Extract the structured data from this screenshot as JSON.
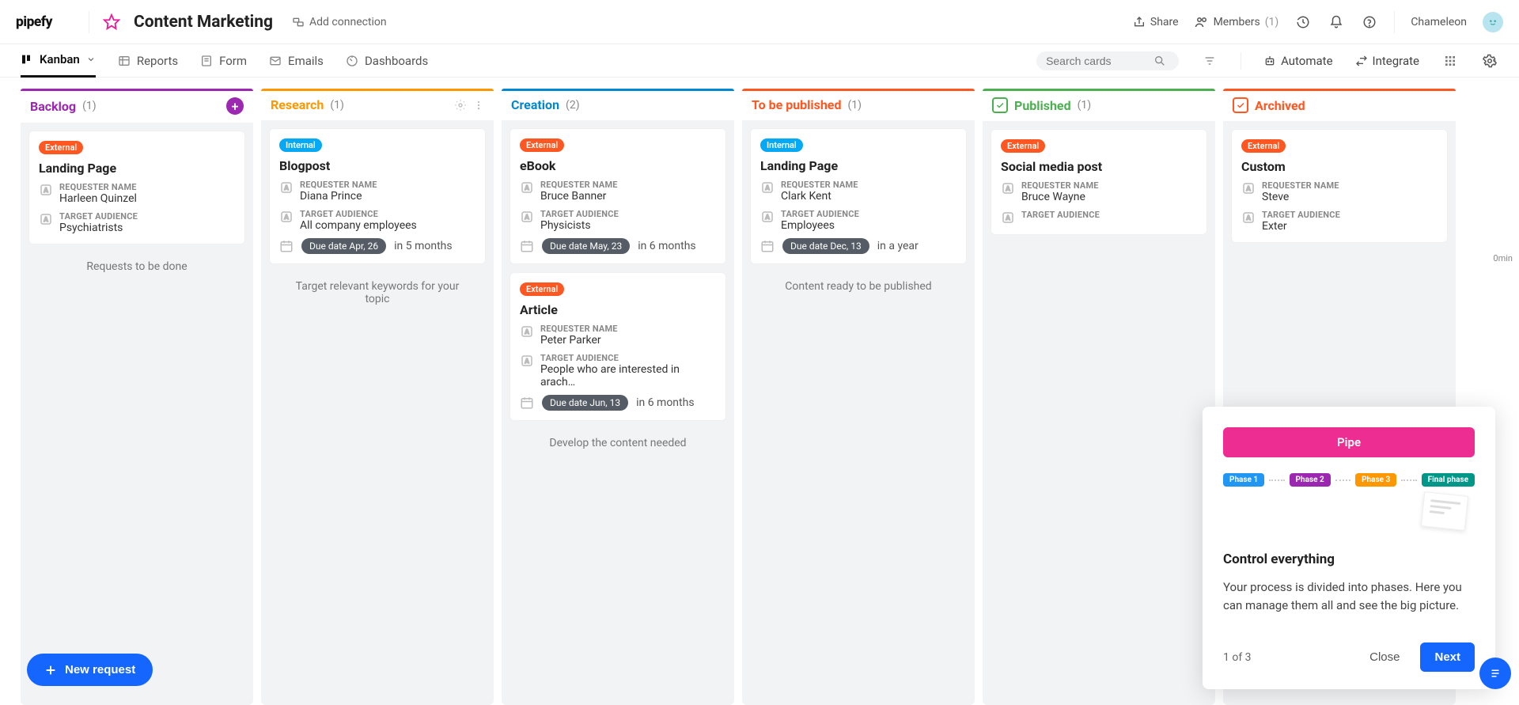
{
  "header": {
    "pipe_title": "Content Marketing",
    "add_connection": "Add connection",
    "share": "Share",
    "members": "Members",
    "members_count": "(1)",
    "user": "Chameleon"
  },
  "views": {
    "kanban": "Kanban",
    "reports": "Reports",
    "form": "Form",
    "emails": "Emails",
    "dashboards": "Dashboards",
    "search_ph": "Search cards",
    "automate": "Automate",
    "integrate": "Integrate"
  },
  "columns": [
    {
      "id": "backlog",
      "title": "Backlog",
      "count": "(1)",
      "color": "#9c27b0",
      "show_add": true,
      "desc": "Requests to be done",
      "cards": [
        {
          "label_type": "ext",
          "label": "External",
          "title": "Landing Page",
          "fields": [
            {
              "lbl": "REQUESTER NAME",
              "val": "Harleen Quinzel"
            },
            {
              "lbl": "TARGET AUDIENCE",
              "val": "Psychiatrists"
            }
          ]
        }
      ]
    },
    {
      "id": "research",
      "title": "Research",
      "count": "(1)",
      "color": "#ff9800",
      "show_gear": true,
      "desc": "Target relevant keywords for your topic",
      "cards": [
        {
          "label_type": "int",
          "label": "Internal",
          "title": "Blogpost",
          "fields": [
            {
              "lbl": "REQUESTER NAME",
              "val": "Diana Prince"
            },
            {
              "lbl": "TARGET AUDIENCE",
              "val": "All company employees"
            }
          ],
          "due": "Due date Apr, 26",
          "rel": "in 5 months"
        }
      ]
    },
    {
      "id": "creation",
      "title": "Creation",
      "count": "(2)",
      "color": "#0288d1",
      "desc": "Develop the content needed",
      "cards": [
        {
          "label_type": "ext",
          "label": "External",
          "title": "eBook",
          "fields": [
            {
              "lbl": "REQUESTER NAME",
              "val": "Bruce Banner"
            },
            {
              "lbl": "TARGET AUDIENCE",
              "val": "Physicists"
            }
          ],
          "due": "Due date May, 23",
          "rel": "in 6 months"
        },
        {
          "label_type": "ext",
          "label": "External",
          "title": "Article",
          "fields": [
            {
              "lbl": "REQUESTER NAME",
              "val": "Peter Parker"
            },
            {
              "lbl": "TARGET AUDIENCE",
              "val": "People who are interested in arach…"
            }
          ],
          "due": "Due date Jun, 13",
          "rel": "in 6 months"
        }
      ]
    },
    {
      "id": "publish",
      "title": "To be published",
      "count": "(1)",
      "color": "#ff5722",
      "desc": "Content ready to be published",
      "cards": [
        {
          "label_type": "int",
          "label": "Internal",
          "title": "Landing Page",
          "fields": [
            {
              "lbl": "REQUESTER NAME",
              "val": "Clark Kent"
            },
            {
              "lbl": "TARGET AUDIENCE",
              "val": "Employees"
            }
          ],
          "due": "Due date Dec, 13",
          "rel": "in a year"
        }
      ]
    },
    {
      "id": "published",
      "title": "Published",
      "count": "(1)",
      "color": "#4caf50",
      "done": true,
      "done_color": "#4caf50",
      "cards": [
        {
          "label_type": "ext",
          "label": "External",
          "title": "Social media post",
          "fields": [
            {
              "lbl": "REQUESTER NAME",
              "val": "Bruce Wayne"
            },
            {
              "lbl": "TARGET AUDIENCE",
              "val": ""
            }
          ]
        }
      ]
    },
    {
      "id": "archived",
      "title": "Archived",
      "count": "",
      "color": "#ff5722",
      "done": true,
      "done_color": "#ff5722",
      "cards": [
        {
          "label_type": "ext",
          "label": "External",
          "title": "Custom",
          "fields": [
            {
              "lbl": "REQUESTER NAME",
              "val": "Steve"
            },
            {
              "lbl": "TARGET AUDIENCE",
              "val": "Exter"
            }
          ]
        }
      ]
    }
  ],
  "new_request": "New request",
  "tour": {
    "pipe": "Pipe",
    "phases": [
      {
        "label": "Phase 1",
        "color": "#2196f3"
      },
      {
        "label": "Phase 2",
        "color": "#9c27b0"
      },
      {
        "label": "Phase 3",
        "color": "#ff9800"
      },
      {
        "label": "Final phase",
        "color": "#009688"
      }
    ],
    "heading": "Control everything",
    "body": "Your process is divided into phases. Here you can manage them all and see the big picture.",
    "step": "1 of 3",
    "close": "Close",
    "next": "Next"
  },
  "min": "0min"
}
